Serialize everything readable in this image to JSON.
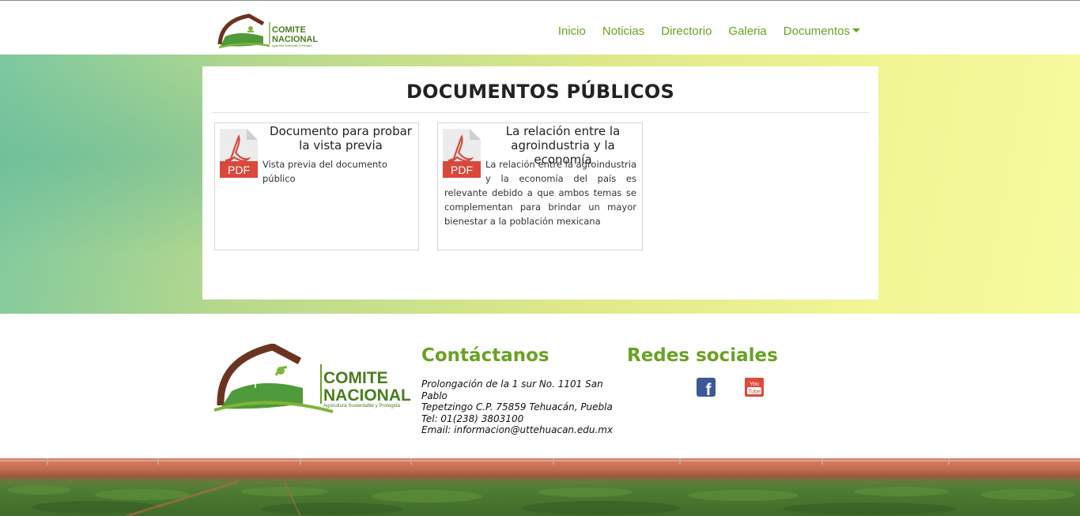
{
  "header": {
    "logo": {
      "line1": "COMITE",
      "line2": "NACIONAL",
      "tagline": "Agricultura Sustentable y Protegida"
    },
    "nav": [
      {
        "label": "Inicio"
      },
      {
        "label": "Noticias"
      },
      {
        "label": "Directorio"
      },
      {
        "label": "Galeria"
      },
      {
        "label": "Documentos",
        "dropdown": true
      }
    ]
  },
  "main": {
    "title": "DOCUMENTOS PÚBLICOS",
    "documents": [
      {
        "icon": "pdf-icon",
        "icon_label": "PDF",
        "title": "Documento para probar la vista previa",
        "description": "Vista previa del documento público"
      },
      {
        "icon": "pdf-icon",
        "icon_label": "PDF",
        "title": "La relación entre la agroindustria y la economía",
        "description": "La relación entre la agroindustria y la economía del país es relevante debido a que ambos temas se complementan para brindar un mayor bienestar a la población mexicana"
      }
    ]
  },
  "footer": {
    "logo": {
      "line1": "COMITE",
      "line2": "NACIONAL",
      "tagline": "Agricultura Sustentable y Protegida"
    },
    "contact_title": "Contáctanos",
    "contact_lines": [
      "Prolongación de la 1 sur No. 1101 San Pablo",
      "Tepetzingo C.P. 75859 Tehuacán, Puebla",
      "Tel: 01(238) 3803100",
      "Email: informacion@uttehuacan.edu.mx"
    ],
    "social_title": "Redes sociales",
    "social": [
      {
        "icon": "facebook-icon",
        "label": "f"
      },
      {
        "icon": "youtube-icon",
        "label_top": "You",
        "label_bottom": "Tube"
      }
    ]
  },
  "colors": {
    "accent_green": "#6aa122",
    "logo_brown": "#6b3320",
    "pdf_red": "#d9483b",
    "facebook_blue": "#3b5998",
    "youtube_red": "#dd4b39"
  }
}
